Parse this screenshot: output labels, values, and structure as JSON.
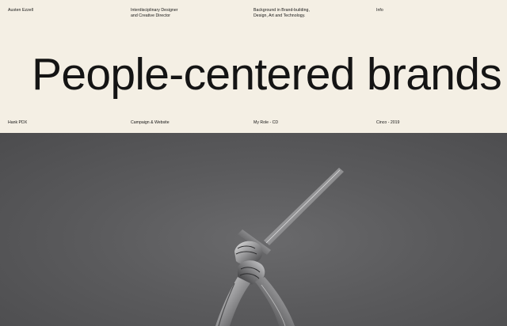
{
  "nav": {
    "name": "Austen Ezzell",
    "role": [
      "Interdisciplinary Designer",
      "and Creative Director"
    ],
    "background": [
      "Background in Brand-building,",
      "Design, Art and Technology."
    ],
    "info": "Info"
  },
  "headline": "People-centered brands",
  "project": {
    "client": "Hank PDX",
    "type": "Campaign & Website",
    "my_role": "My Role - CD",
    "agency": "Cinco - 2019"
  },
  "hero": {
    "image_subject": "sculpture-hands-gripping-sword"
  },
  "colors": {
    "background": "#f4efe4",
    "text": "#141414",
    "hero_background": "#5b5b5d"
  }
}
